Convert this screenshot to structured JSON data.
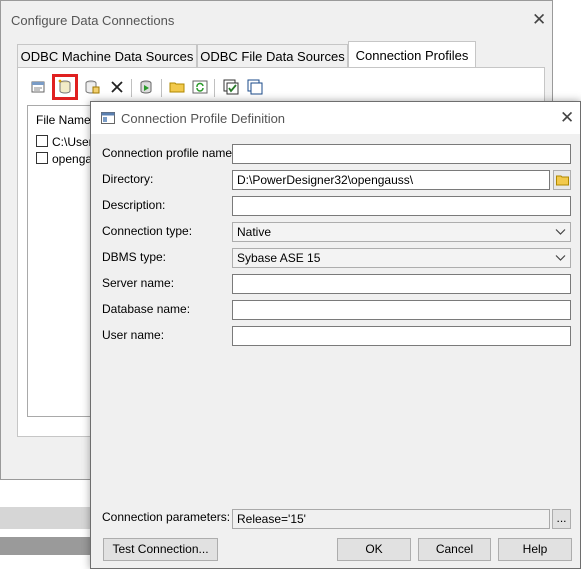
{
  "back_window": {
    "title": "Configure Data Connections",
    "close_glyph": "✕",
    "tabs": [
      {
        "label": "ODBC Machine Data Sources"
      },
      {
        "label": "ODBC File Data Sources"
      },
      {
        "label": "Connection Profiles"
      }
    ],
    "toolbar_icons": [
      "properties-icon",
      "new-connection-profile-icon",
      "copy-profile-icon",
      "delete-icon",
      "test-connection-icon",
      "open-folder-icon",
      "refresh-icon",
      "check-all-icon",
      "uncheck-all-icon"
    ],
    "file_list": {
      "header": "File Name",
      "rows": [
        "C:\\Users",
        "opengau"
      ]
    }
  },
  "dialog": {
    "title": "Connection Profile Definition",
    "close_glyph": "✕",
    "fields": {
      "profile_name": {
        "label": "Connection profile name:",
        "value": ""
      },
      "directory": {
        "label": "Directory:",
        "value": "D:\\PowerDesigner32\\opengauss\\"
      },
      "description": {
        "label": "Description:",
        "value": ""
      },
      "connection_type": {
        "label": "Connection type:",
        "value": "Native"
      },
      "dbms_type": {
        "label": "DBMS type:",
        "value": "Sybase ASE 15"
      },
      "server_name": {
        "label": "Server name:",
        "value": ""
      },
      "database_name": {
        "label": "Database name:",
        "value": ""
      },
      "user_name": {
        "label": "User name:",
        "value": ""
      },
      "connection_parameters": {
        "label": "Connection parameters:",
        "value": "Release='15'"
      }
    },
    "buttons": {
      "dots": "...",
      "test_connection": "Test Connection...",
      "ok": "OK",
      "cancel": "Cancel",
      "help": "Help"
    }
  },
  "colors": {
    "highlight": "#e02020",
    "window_bg": "#f0f0f0"
  }
}
